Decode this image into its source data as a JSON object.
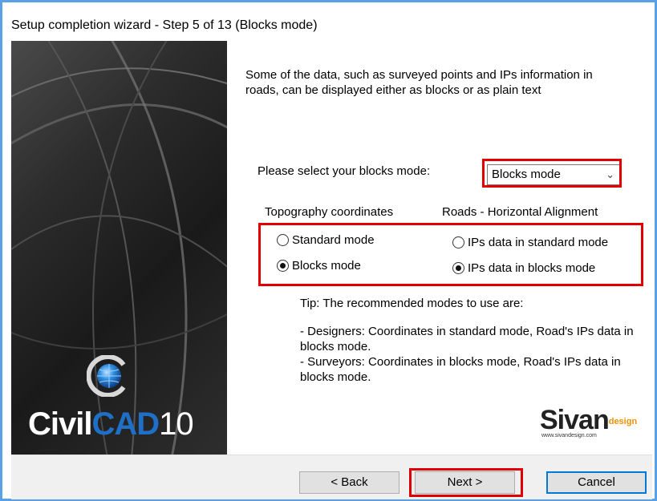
{
  "window": {
    "title": "Setup completion wizard - Step 5 of 13  (Blocks mode)"
  },
  "sidebar": {
    "logo_civil": "Civil",
    "logo_cad": "CAD",
    "logo_version": "10"
  },
  "intro_text": "Some of the data, such as surveyed points and IPs information in roads, can be displayed either as blocks or as plain text",
  "blocks_select": {
    "label": "Please select your blocks mode:",
    "value": "Blocks mode"
  },
  "topography": {
    "heading": "Topography coordinates",
    "options": [
      {
        "label": "Standard mode",
        "selected": false
      },
      {
        "label": "Blocks mode",
        "selected": true
      }
    ]
  },
  "roads": {
    "heading": "Roads - Horizontal Alignment",
    "options": [
      {
        "label": "IPs data in standard mode",
        "selected": false
      },
      {
        "label": "IPs data in blocks mode",
        "selected": true
      }
    ]
  },
  "tip": {
    "heading": "Tip: The recommended modes to use are:",
    "line1": "- Designers: Coordinates in standard mode, Road's IPs data in blocks mode.",
    "line2": "- Surveyors: Coordinates in blocks mode, Road's IPs data in blocks mode."
  },
  "brand": {
    "name": "Sivan",
    "suffix": "design",
    "url": "www.sivandesign.com"
  },
  "buttons": {
    "back": "< Back",
    "next": "Next >",
    "cancel": "Cancel"
  },
  "colors": {
    "highlight": "#e00000",
    "window_border": "#5aa0e4",
    "brand_orange": "#f29000",
    "cad_blue": "#1f6fc6"
  }
}
